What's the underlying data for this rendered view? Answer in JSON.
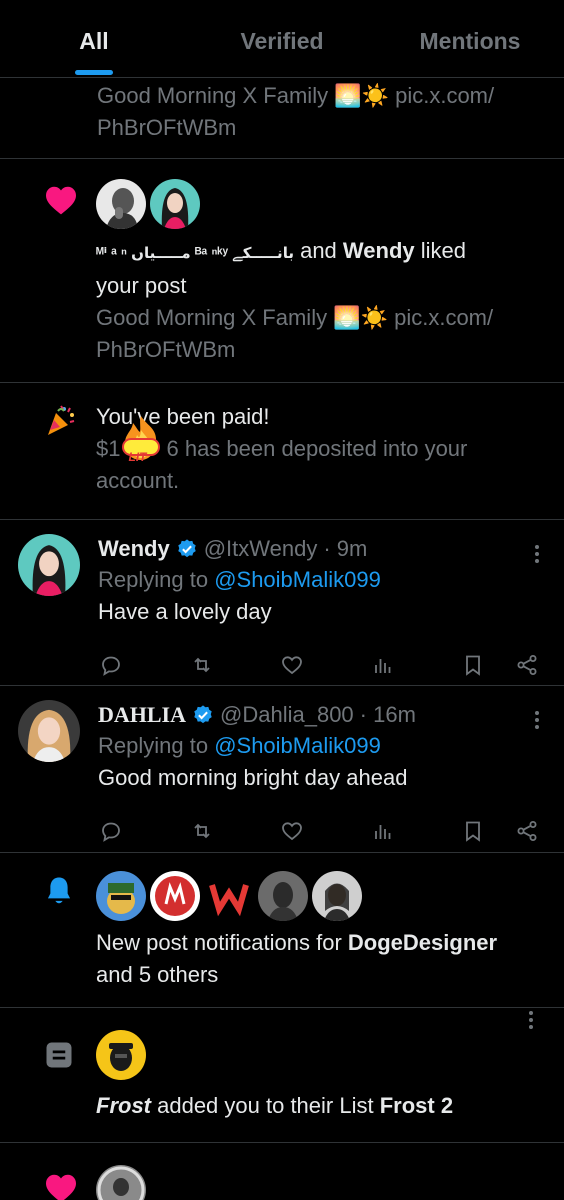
{
  "tabs": [
    {
      "label": "All",
      "active": true
    },
    {
      "label": "Verified",
      "active": false
    },
    {
      "label": "Mentions",
      "active": false
    }
  ],
  "prev_post": {
    "text": "Good Morning X Family 🌅☀️ pic.x.com/",
    "text2": "PhBrOFtWBm"
  },
  "like_notif": {
    "user1_name": "ᴹⁱ ᵃ ⁿ ﻣـــــیاں ᴮᵃ ⁿᵏʸ ﺑﺎﻧـــــﮑﮯ",
    "and_text": " and ",
    "user2_name": "Wendy",
    "action": " liked",
    "action2": "your post",
    "post_text": "Good Morning X Family 🌅☀️ pic.x.com/",
    "post_text2": "PhBrOFtWBm"
  },
  "paid_notif": {
    "title": "You've been paid!",
    "body_prefix": "$1",
    "sticker": "LIT",
    "body": "6 has been deposited into your",
    "body2": "account."
  },
  "tweets": [
    {
      "name": "Wendy",
      "handle": "@ItxWendy",
      "time": "· 9m",
      "replying_label": "Replying to ",
      "replying_to": "@ShoibMalik099",
      "text": "Have a lovely day"
    },
    {
      "name": "DAHLIA",
      "handle": "@Dahlia_800",
      "time": "· 16m",
      "replying_label": "Replying to ",
      "replying_to": "@ShoibMalik099",
      "text": "Good morning bright day ahead"
    }
  ],
  "post_notif": {
    "prefix": "New post notifications for ",
    "user": "DogeDesigner",
    "suffix": "",
    "line2": "and 5 others"
  },
  "list_notif": {
    "user": "Frost",
    "middle": " added you to their List ",
    "list_name": "Frost 2"
  },
  "colors": {
    "background": "#000000",
    "text": "#e7e9ea",
    "secondary": "#71767b",
    "accent": "#1d9bf0",
    "like": "#f91880",
    "divider": "#2f3336"
  }
}
